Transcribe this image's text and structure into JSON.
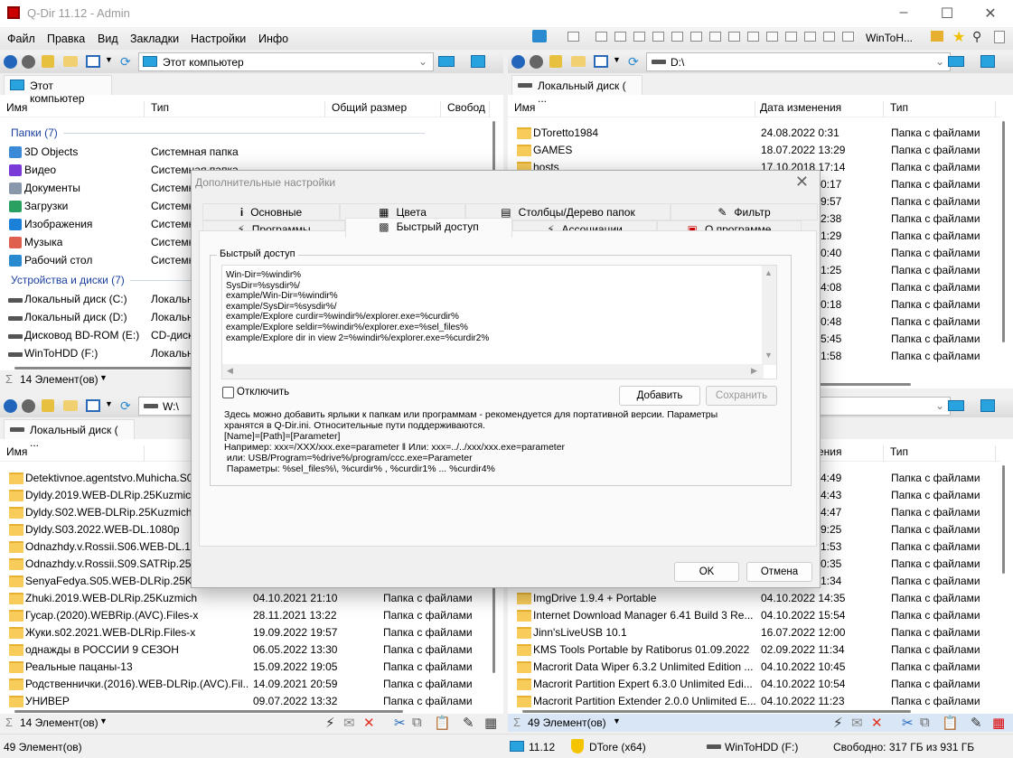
{
  "window": {
    "title": "Q-Dir 11.12 - Admin"
  },
  "menu": [
    "Файл",
    "Правка",
    "Вид",
    "Закладки",
    "Настройки",
    "Инфо"
  ],
  "toolbar": {
    "drive_dropdown": "WinToH..."
  },
  "panes": {
    "top_left": {
      "address": "Этот компьютер",
      "tab": "Этот компьютер",
      "columns": [
        "Имя",
        "Тип",
        "Общий размер",
        "Свобод"
      ],
      "groups": [
        {
          "label": "Папки (7)",
          "items": [
            [
              "3D Objects",
              "Системная папка"
            ],
            [
              "Видео",
              "Системная папка"
            ],
            [
              "Документы",
              "Системн"
            ],
            [
              "Загрузки",
              "Системн"
            ],
            [
              "Изображения",
              "Системн"
            ],
            [
              "Музыка",
              "Системн"
            ],
            [
              "Рабочий стол",
              "Системн"
            ]
          ]
        },
        {
          "label": "Устройства и диски (7)",
          "items": [
            [
              "Локальный диск (C:)",
              "Локальн"
            ],
            [
              "Локальный диск (D:)",
              "Локальн"
            ],
            [
              "Дисковод BD-ROM (E:)",
              "CD-диск"
            ],
            [
              "WinToHDD (F:)",
              "Локальн"
            ]
          ]
        }
      ],
      "status": "14 Элемент(ов)"
    },
    "top_right": {
      "address": "D:\\",
      "tab": "Локальный диск ( ...",
      "columns": [
        "Имя",
        "Дата изменения",
        "Тип"
      ],
      "rows": [
        [
          "DToretto1984",
          "24.08.2022 0:31",
          "Папка с файлами"
        ],
        [
          "GAMES",
          "18.07.2022 13:29",
          "Папка с файлами"
        ],
        [
          "hosts",
          "17.10.2018 17:14",
          "Папка с файлами"
        ],
        [
          "",
          "0:17",
          "Папка с файлами"
        ],
        [
          "",
          "9:57",
          "Папка с файлами"
        ],
        [
          "",
          "2:38",
          "Папка с файлами"
        ],
        [
          "",
          "1:29",
          "Папка с файлами"
        ],
        [
          "",
          "0:40",
          "Папка с файлами"
        ],
        [
          "",
          "1:25",
          "Папка с файлами"
        ],
        [
          "",
          "4:08",
          "Папка с файлами"
        ],
        [
          "",
          "0:18",
          "Папка с файлами"
        ],
        [
          "",
          "0:48",
          "Папка с файлами"
        ],
        [
          "",
          "5:45",
          "Папка с файлами"
        ],
        [
          "",
          "1:58",
          "Папка с файлами"
        ]
      ]
    },
    "bottom_left": {
      "address": "W:\\",
      "tab": "Локальный диск ( ...",
      "columns": [
        "Имя"
      ],
      "rows": [
        [
          "Detektivnoe.agentstvo.Muhicha.S0",
          "",
          ""
        ],
        [
          "Dyldy.2019.WEB-DLRip.25Kuzmich",
          "",
          ""
        ],
        [
          "Dyldy.S02.WEB-DLRip.25Kuzmich",
          "",
          ""
        ],
        [
          "Dyldy.S03.2022.WEB-DL.1080p",
          "",
          ""
        ],
        [
          "Odnazhdy.v.Rossii.S06.WEB-DL.108",
          "",
          ""
        ],
        [
          "Odnazhdy.v.Rossii.S09.SATRip.25Ku",
          "",
          ""
        ],
        [
          "SenyaFedya.S05.WEB-DLRip.25Kuzr",
          "",
          ""
        ],
        [
          "Zhuki.2019.WEB-DLRip.25Kuzmich",
          "04.10.2021 21:10",
          "Папка с файлами"
        ],
        [
          "Гусар.(2020).WEBRip.(AVC).Files-x",
          "28.11.2021 13:22",
          "Папка с файлами"
        ],
        [
          "Жуки.s02.2021.WEB-DLRip.Files-x",
          "19.09.2022 19:57",
          "Папка с файлами"
        ],
        [
          "однажды в РОССИИ 9 СЕЗОН",
          "06.05.2022 13:30",
          "Папка с файлами"
        ],
        [
          "Реальные пацаны-13",
          "15.09.2022 19:05",
          "Папка с файлами"
        ],
        [
          "Родственнички.(2016).WEB-DLRip.(AVC).Fil...",
          "14.09.2021 20:59",
          "Папка с файлами"
        ],
        [
          "УНИВЕР",
          "09.07.2022 13:32",
          "Папка с файлами"
        ]
      ],
      "status": "14 Элемент(ов)"
    },
    "bottom_right": {
      "columns": [
        "ения",
        "Тип"
      ],
      "rows": [
        [
          "",
          "4:49",
          "Папка с файлами"
        ],
        [
          "",
          "4:43",
          "Папка с файлами"
        ],
        [
          "",
          "4:47",
          "Папка с файлами"
        ],
        [
          "",
          "9:25",
          "Папка с файлами"
        ],
        [
          "",
          "1:53",
          "Папка с файлами"
        ],
        [
          "",
          "0:35",
          "Папка с файлами"
        ],
        [
          "",
          "1:34",
          "Папка с файлами"
        ],
        [
          "ImgDrive 1.9.4 + Portable",
          "04.10.2022 14:35",
          "Папка с файлами"
        ],
        [
          "Internet Download Manager 6.41 Build 3 Re...",
          "04.10.2022 15:54",
          "Папка с файлами"
        ],
        [
          "Jinn'sLiveUSB 10.1",
          "16.07.2022 12:00",
          "Папка с файлами"
        ],
        [
          "KMS Tools Portable by Ratiborus 01.09.2022",
          "02.09.2022 11:34",
          "Папка с файлами"
        ],
        [
          "Macrorit Data Wiper 6.3.2 Unlimited Edition ...",
          "04.10.2022 10:45",
          "Папка с файлами"
        ],
        [
          "Macrorit Partition Expert 6.3.0 Unlimited Edi...",
          "04.10.2022 10:54",
          "Папка с файлами"
        ],
        [
          "Macrorit Partition Extender 2.0.0 Unlimited E...",
          "04.10.2022 11:23",
          "Папка с файлами"
        ]
      ],
      "status": "49 Элемент(ов)"
    }
  },
  "statusbar": {
    "left": "49 Элемент(ов)",
    "version": "11.12",
    "user": "DTore (x64)",
    "drive": "WinToHDD (F:)",
    "free": "Свободно: 317 ГБ из 931 ГБ"
  },
  "dialog": {
    "title": "Дополнительные настройки",
    "tabs_row1": [
      "Основные",
      "Цвета",
      "Столбцы/Дерево папок",
      "Фильтр"
    ],
    "tabs_row2": [
      "Программы",
      "Быстрый доступ",
      "Ассоциации",
      "О программе"
    ],
    "selected_tab": "Быстрый доступ",
    "group_label": "Быстрый доступ",
    "text_lines": [
      "Win-Dir=%windir%",
      "SysDir=%sysdir%/",
      "example/Win-Dir=%windir%",
      "example/SysDir=%sysdir%/",
      "example/Explore curdir=%windir%/explorer.exe=%curdir%",
      "example/Explore seldir=%windir%/explorer.exe=%sel_files%",
      "example/Explore dir in view 2=%windir%/explorer.exe=%curdir2%"
    ],
    "disable_label": "Отключить",
    "disable_checked": false,
    "add_button": "Добавить",
    "save_button": "Сохранить",
    "info": "Здесь можно добавить ярлыки к папкам или программам - рекомендуется для портативной версии. Параметры\nхранятся в Q-Dir.ini. Относительные пути поддерживаются.\n[Name]=[Path]=[Parameter]\nНапример: xxx=/XXX/xxx.exe=parameter ‖ Или: xxx=../../xxx/xxx.exe=parameter\n или: USB/Program=%drive%/program/ccc.exe=Parameter\n Параметры: %sel_files%\\, %curdir% , %curdir1% ... %curdir4%",
    "ok_button": "OK",
    "cancel_button": "Отмена"
  },
  "colors": {
    "folder": "#f8cc5a",
    "group_text": "#1a3f9e",
    "active_status": "#d8e6f6",
    "delete_red": "#e03020"
  }
}
